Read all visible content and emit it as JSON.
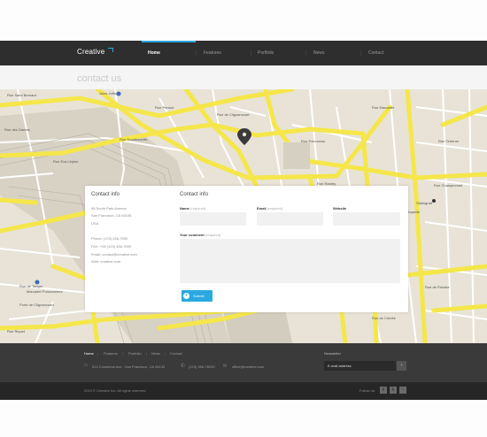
{
  "nav": {
    "logo": "Creative",
    "items": [
      "Home",
      "Features",
      "Portfolio",
      "News",
      "Contact"
    ],
    "active": "Home"
  },
  "page": {
    "title": "contact us"
  },
  "map": {
    "street_labels": [
      "Rue Saint Bernard",
      "Rue Peraud",
      "Rue des Dames",
      "Rue Eva Lépine",
      "Rue de Clignancourt",
      "Rue Polonceau",
      "Rue Ramey",
      "Rue Doudeauville",
      "Rue Marcadet",
      "Rue Ordener",
      "Rue Championnet",
      "Rue de la Chapelle",
      "Rue Riquet",
      "Rue de Tanger",
      "Rue de Flandre",
      "Rue de Crimée"
    ],
    "place_labels": [
      "Jules Joffrin",
      "Marcadet Poissonniers",
      "Porte de Clignancourt",
      "Stalingrad"
    ]
  },
  "contact_info": {
    "title": "Contact info",
    "address_line1": "98 South Park Avenue",
    "address_line2": "San Francisco, CA 94108",
    "country": "USA",
    "phone": "Phone: (123) 456-7890",
    "fax": "FAX: +08 (123) 456-7890",
    "email": "Email: contact@creative.com",
    "web": "Web: creative.com"
  },
  "contact_form": {
    "title": "Contact info",
    "name_label": "Name",
    "email_label": "Email",
    "website_label": "Website",
    "comment_label": "Your comment",
    "required_text": "(required)",
    "submit_label": "Submit"
  },
  "footer": {
    "nav": [
      "Home",
      "Features",
      "Portfolio",
      "News",
      "Contact"
    ],
    "address": "514 Columbus Ave., San Francisco, CA 94133",
    "phone": "(123) 456-78910",
    "email": "office@creative.com",
    "newsletter_title": "Newsletter",
    "newsletter_placeholder": "E-mail address",
    "copyright": "2013 © Creative Inc. All rights reserved",
    "follow": "Follow us:"
  },
  "colors": {
    "accent": "#2aa9e0",
    "nav_bg": "#2e2e2e",
    "footer_bg": "#3a3a3a",
    "map_road": "#f5e64a"
  }
}
